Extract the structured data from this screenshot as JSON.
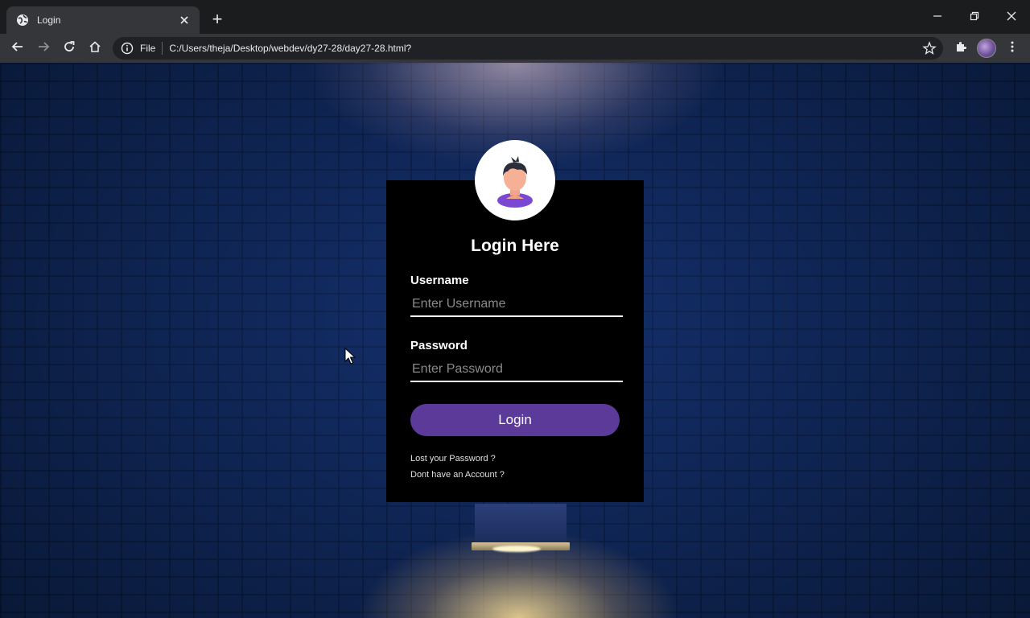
{
  "browser": {
    "tab_title": "Login",
    "new_tab_symbol": "+",
    "scheme_label": "File",
    "url": "C:/Users/theja/Desktop/webdev/dy27-28/day27-28.html?"
  },
  "icons": {
    "tab": "globe-icon",
    "close": "close-icon",
    "back": "back-arrow-icon",
    "forward": "forward-arrow-icon",
    "reload": "reload-icon",
    "home": "home-icon",
    "info": "info-icon",
    "bookmark": "star-icon",
    "extensions": "puzzle-icon",
    "menu": "kebab-menu-icon"
  },
  "login": {
    "title": "Login Here",
    "username_label": "Username",
    "username_placeholder": "Enter Username",
    "username_value": "",
    "password_label": "Password",
    "password_placeholder": "Enter Password",
    "password_value": "",
    "submit_label": "Login",
    "lost_password": "Lost your Password ?",
    "no_account": "Dont have an Account ?"
  },
  "colors": {
    "accent": "#5b3a9a",
    "card": "#000000",
    "wall": "#0f2a5e"
  }
}
